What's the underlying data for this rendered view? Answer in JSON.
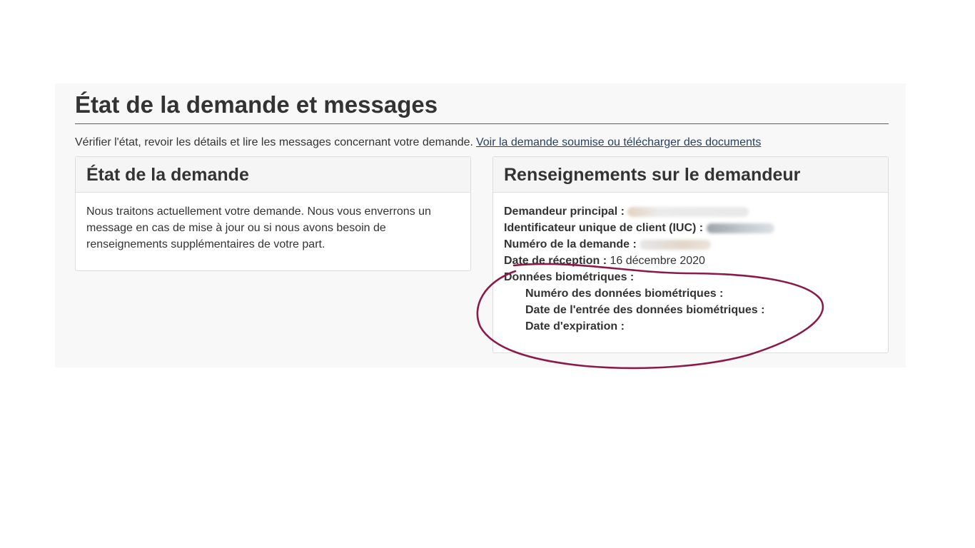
{
  "page": {
    "title": "État de la demande et messages",
    "intro_text": "Vérifier l'état, revoir les détails et lire les messages concernant votre demande.",
    "intro_link": "Voir la demande soumise ou télécharger des documents"
  },
  "status_panel": {
    "heading": "État de la demande",
    "body": "Nous traitons actuellement votre demande. Nous vous enverrons un message en cas de mise à jour ou si nous avons besoin de renseignements supplémentaires de votre part."
  },
  "applicant_panel": {
    "heading": "Renseignements sur le demandeur",
    "principal_applicant_label": "Demandeur principal :",
    "uci_label": "Identificateur unique de client (IUC) :",
    "application_number_label": "Numéro de la demande :",
    "received_date_label": "Date de réception :",
    "received_date_value": "16 décembre 2020",
    "biometrics_label": "Données biométriques :",
    "biometrics_number_label": "Numéro des données biométriques :",
    "biometrics_entry_date_label": "Date de l'entrée des données biométriques :",
    "expiry_date_label": "Date d'expiration :"
  },
  "colors": {
    "title_rule": "#af3c43",
    "link": "#284162",
    "annotation": "#8b1a4a"
  }
}
